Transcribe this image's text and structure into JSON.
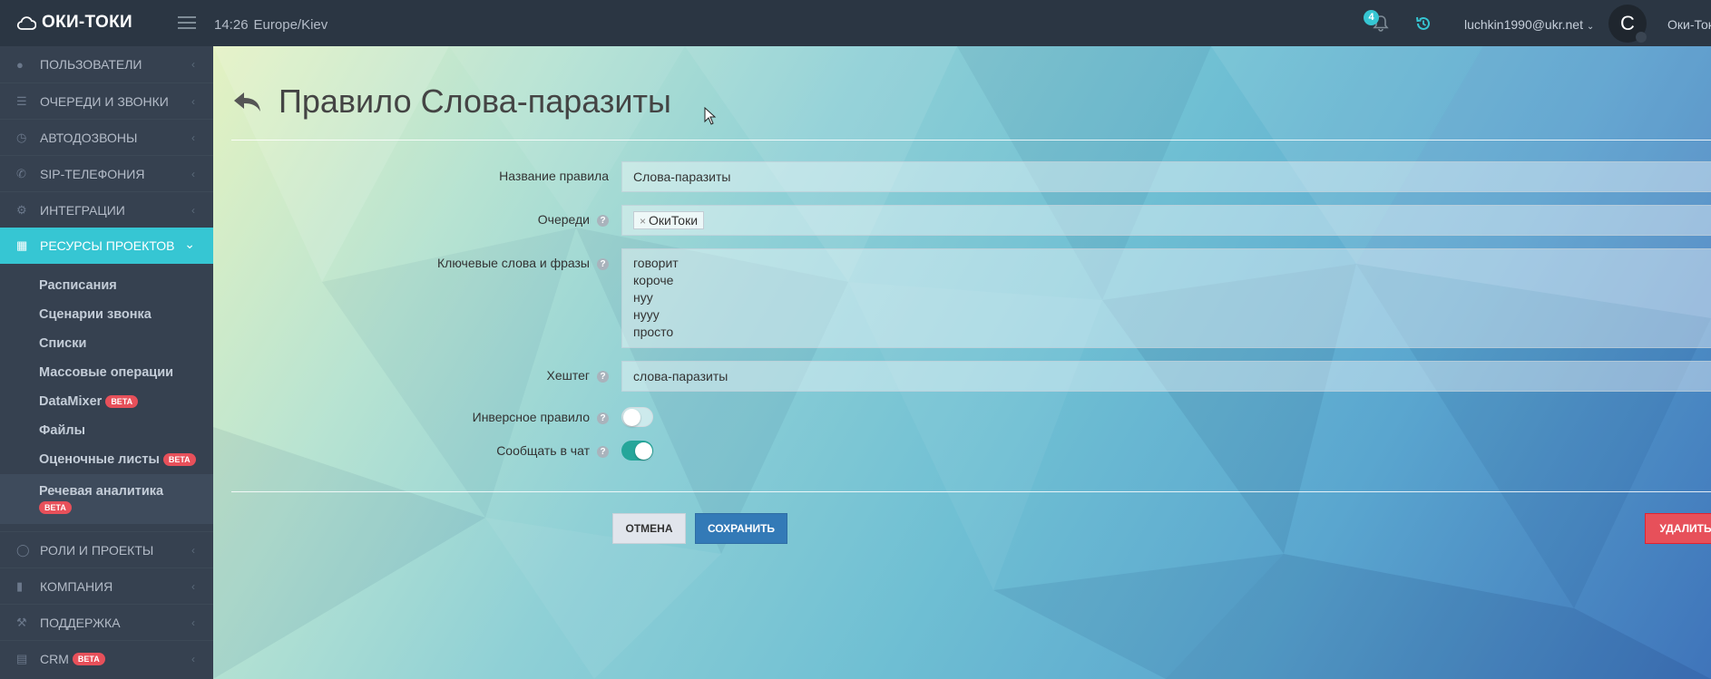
{
  "header": {
    "logo_text": "ОКИ-ТОКИ",
    "time": "14:26",
    "timezone": "Europe/Kiev",
    "notification_count": "4",
    "user_email": "luchkin1990@ukr.net",
    "avatar_letter": "C",
    "company": "Оки-Токи"
  },
  "sidebar": {
    "items_top": [
      {
        "label": "ПОЛЬЗОВАТЕЛИ",
        "icon": "user-icon"
      },
      {
        "label": "ОЧЕРЕДИ И ЗВОНКИ",
        "icon": "list-icon"
      },
      {
        "label": "АВТОДОЗВОНЫ",
        "icon": "clock-icon"
      },
      {
        "label": "SIP-ТЕЛЕФОНИЯ",
        "icon": "phone-icon"
      },
      {
        "label": "ИНТЕГРАЦИИ",
        "icon": "gears-icon"
      }
    ],
    "active_item": {
      "label": "РЕСУРСЫ ПРОЕКТОВ",
      "icon": "grid-icon"
    },
    "subitems": [
      {
        "label": "Расписания"
      },
      {
        "label": "Сценарии звонка"
      },
      {
        "label": "Списки"
      },
      {
        "label": "Массовые операции"
      },
      {
        "label": "DataMixer",
        "badge": "BETA"
      },
      {
        "label": "Файлы"
      },
      {
        "label": "Оценочные листы",
        "badge": "BETA"
      }
    ],
    "current_subitem": {
      "label": "Речевая аналитика",
      "badge": "BETA"
    },
    "items_bottom": [
      {
        "label": "РОЛИ И ПРОЕКТЫ",
        "icon": "toggle-icon"
      },
      {
        "label": "КОМПАНИЯ",
        "icon": "bar-chart-icon"
      },
      {
        "label": "ПОДДЕРЖКА",
        "icon": "wrench-icon"
      },
      {
        "label": "CRM",
        "icon": "table-icon",
        "badge": "BETA"
      }
    ]
  },
  "page": {
    "title": "Правило Слова-паразиты"
  },
  "form": {
    "rule_name_label": "Название правила",
    "rule_name_value": "Слова-паразиты",
    "queues_label": "Очереди",
    "queue_tag": "ОкиТоки",
    "keywords_label": "Ключевые слова и фразы",
    "keywords": [
      "говорит",
      "короче",
      "нуу",
      "нууу",
      "просто"
    ],
    "hashtag_label": "Хештег",
    "hashtag_value": "слова-паразиты",
    "inverse_label": "Инверсное правило",
    "inverse_on": false,
    "chat_label": "Сообщать в чат",
    "chat_on": true
  },
  "buttons": {
    "cancel": "ОТМЕНА",
    "save": "СОХРАНИТЬ",
    "delete": "УДАЛИТЬ"
  },
  "colors": {
    "accent": "#36c6d3",
    "sidebar_bg": "#364150",
    "header_bg": "#2b3643",
    "save": "#337ab7",
    "delete": "#e7505a",
    "toggle_on": "#26a69a"
  }
}
